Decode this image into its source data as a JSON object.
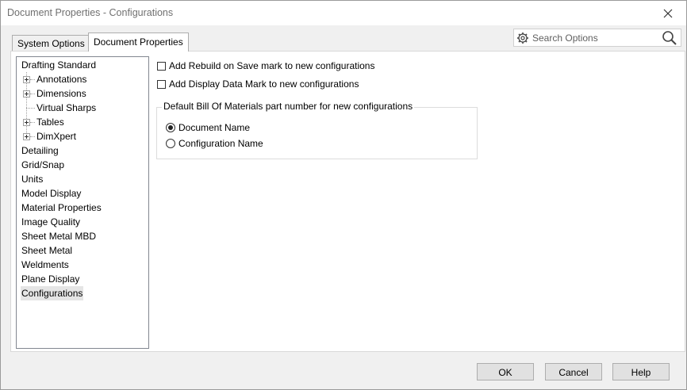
{
  "window": {
    "title": "Document Properties - Configurations"
  },
  "tabs": [
    {
      "label": "System Options",
      "active": false
    },
    {
      "label": "Document Properties",
      "active": true
    }
  ],
  "search": {
    "placeholder": "Search Options"
  },
  "tree": {
    "items": [
      {
        "label": "Drafting Standard",
        "level": 0,
        "expandable": false
      },
      {
        "label": "Annotations",
        "level": 1,
        "expandable": true
      },
      {
        "label": "Dimensions",
        "level": 1,
        "expandable": true
      },
      {
        "label": "Virtual Sharps",
        "level": 1,
        "expandable": false
      },
      {
        "label": "Tables",
        "level": 1,
        "expandable": true
      },
      {
        "label": "DimXpert",
        "level": 1,
        "expandable": true
      },
      {
        "label": "Detailing",
        "level": 0,
        "expandable": false
      },
      {
        "label": "Grid/Snap",
        "level": 0,
        "expandable": false
      },
      {
        "label": "Units",
        "level": 0,
        "expandable": false
      },
      {
        "label": "Model Display",
        "level": 0,
        "expandable": false
      },
      {
        "label": "Material Properties",
        "level": 0,
        "expandable": false
      },
      {
        "label": "Image Quality",
        "level": 0,
        "expandable": false
      },
      {
        "label": "Sheet Metal MBD",
        "level": 0,
        "expandable": false
      },
      {
        "label": "Sheet Metal",
        "level": 0,
        "expandable": false
      },
      {
        "label": "Weldments",
        "level": 0,
        "expandable": false
      },
      {
        "label": "Plane Display",
        "level": 0,
        "expandable": false
      },
      {
        "label": "Configurations",
        "level": 0,
        "expandable": false,
        "selected": true
      }
    ]
  },
  "options": {
    "add_rebuild_label": "Add Rebuild on Save mark to new configurations",
    "add_rebuild_checked": false,
    "add_display_label": "Add Display Data Mark to new configurations",
    "add_display_checked": false
  },
  "bom_group": {
    "legend": "Default Bill Of Materials part number for new configurations",
    "document_name_label": "Document Name",
    "configuration_name_label": "Configuration Name",
    "selected": "Document Name"
  },
  "buttons": {
    "ok": "OK",
    "cancel": "Cancel",
    "help": "Help"
  },
  "icons": {
    "close": "close-icon",
    "gear": "gear-icon",
    "search": "search-icon",
    "expand": "plus-box-icon"
  }
}
